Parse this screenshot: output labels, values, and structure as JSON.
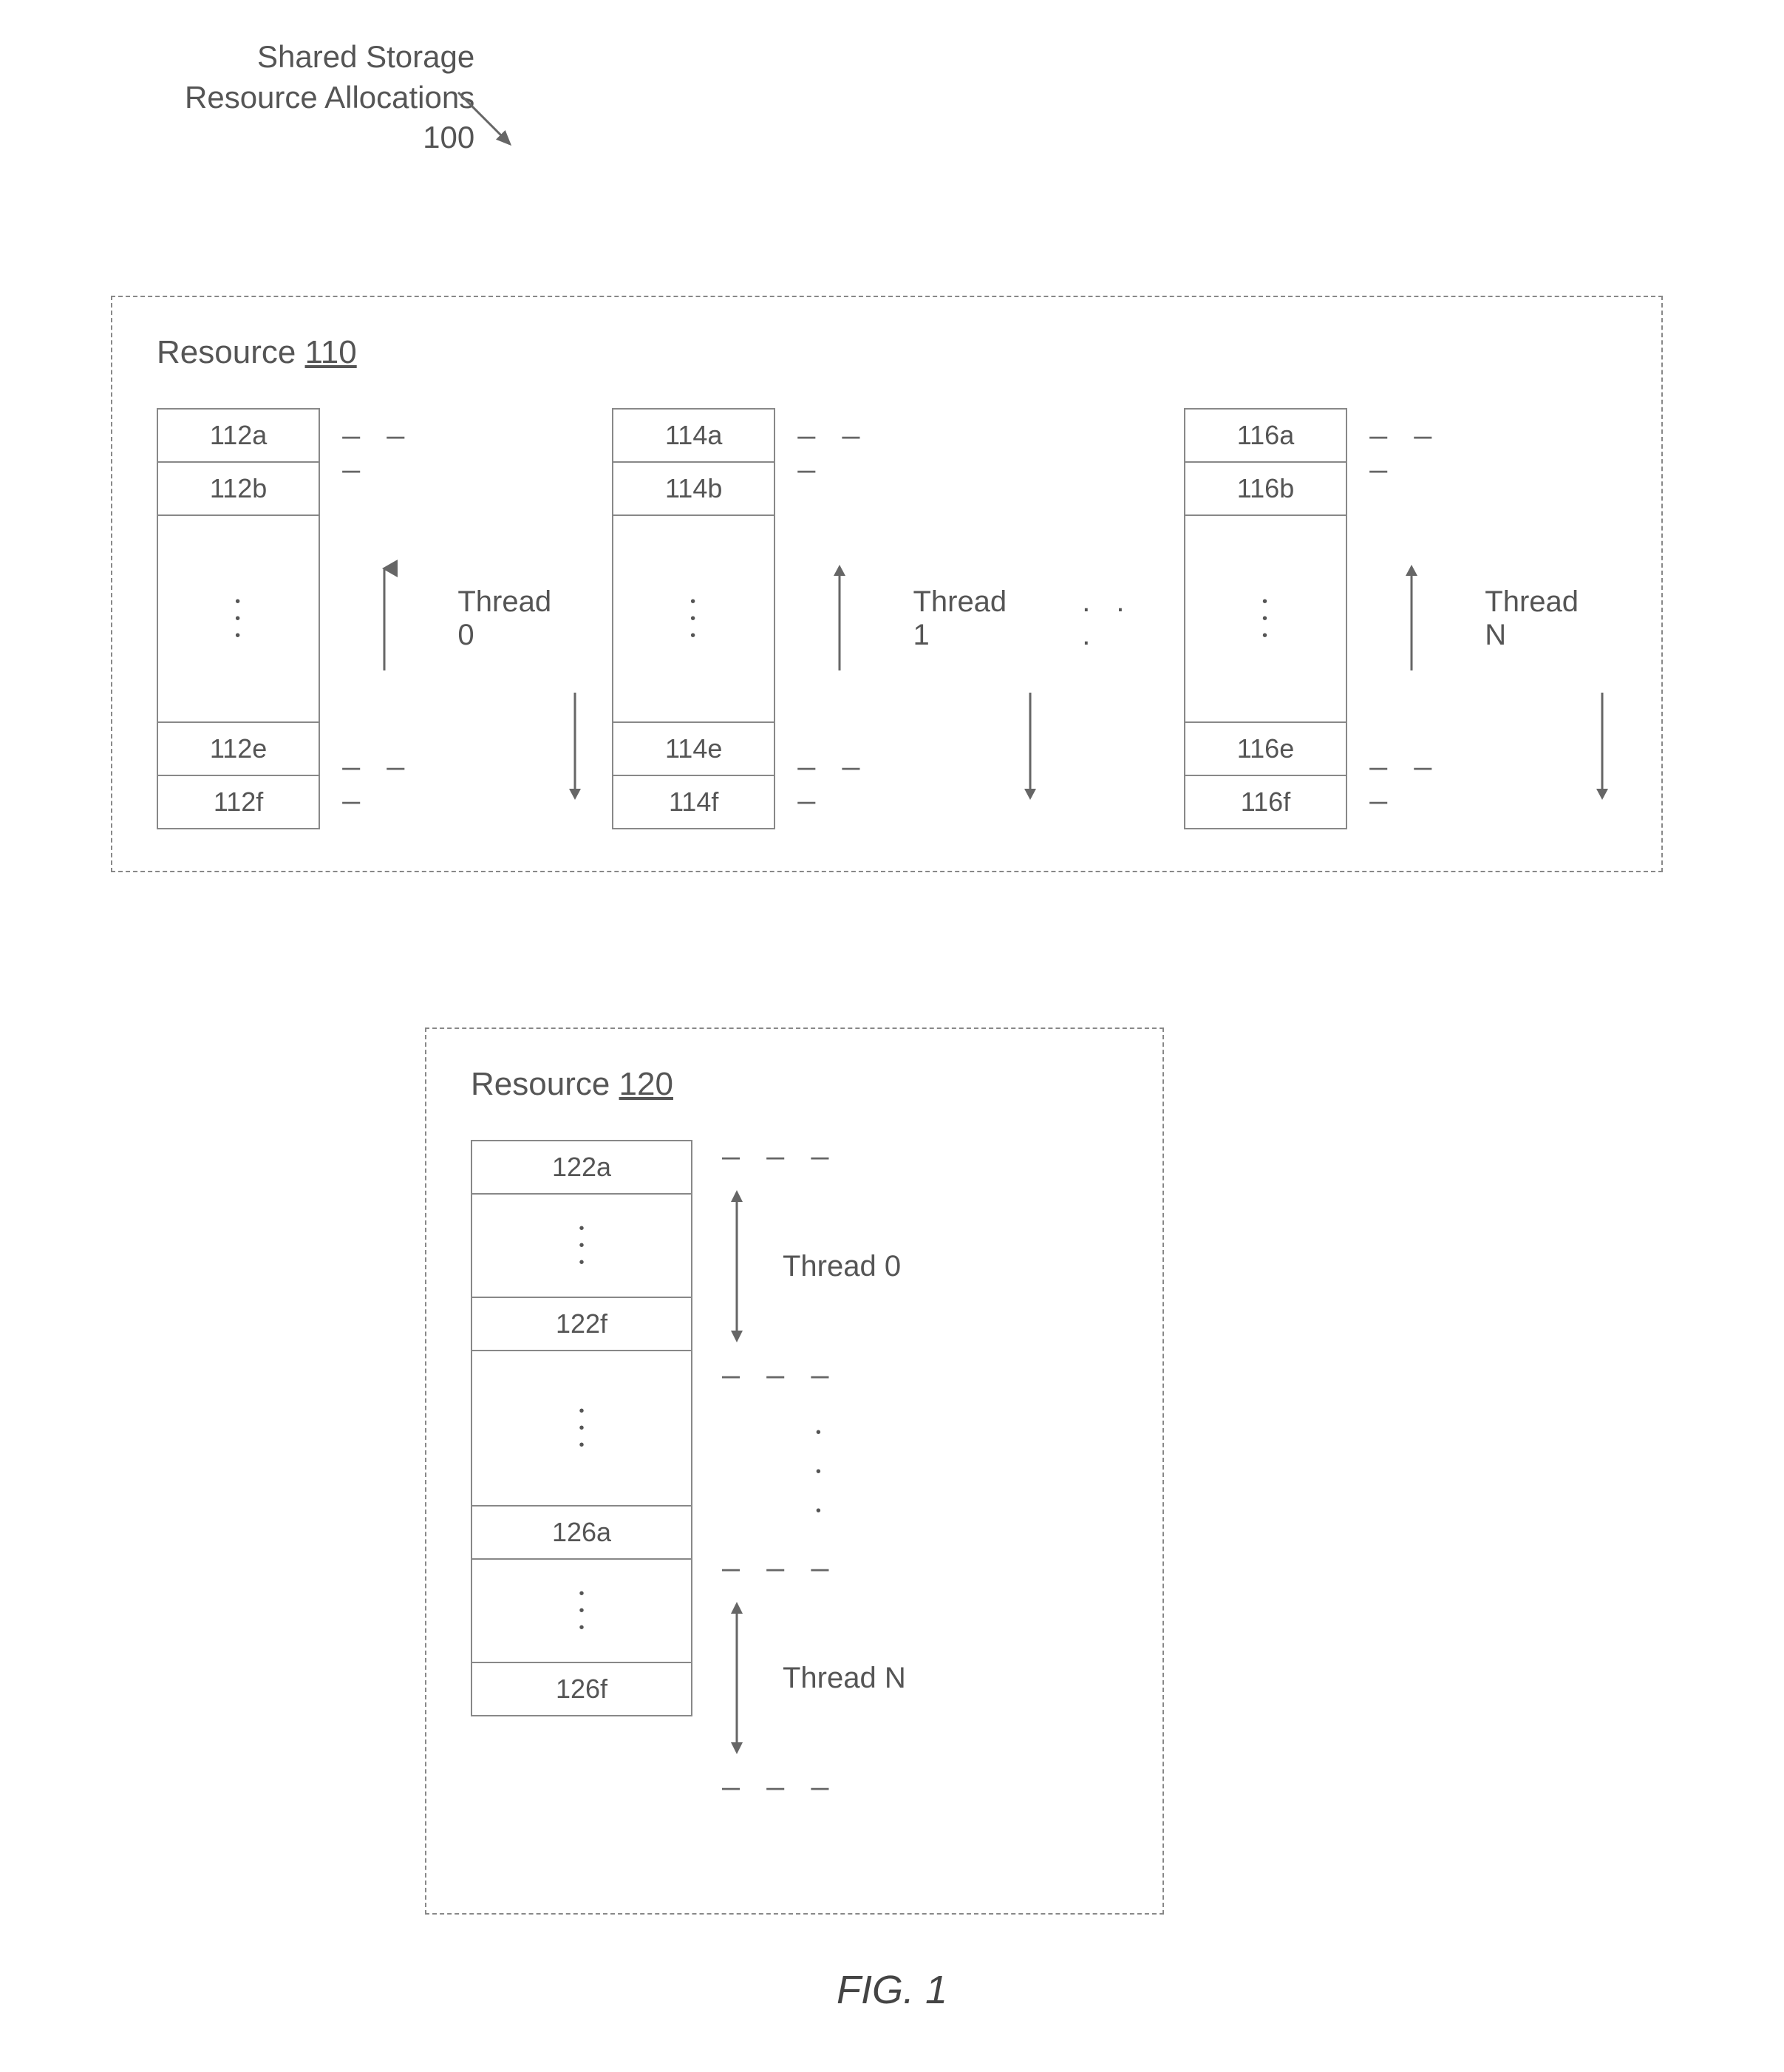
{
  "title": {
    "line1": "Shared Storage",
    "line2": "Resource Allocations",
    "num": "100"
  },
  "resource110": {
    "label": "Resource",
    "num": "110",
    "cols": [
      {
        "a": "112a",
        "b": "112b",
        "e": "112e",
        "f": "112f",
        "thread": "Thread 0"
      },
      {
        "a": "114a",
        "b": "114b",
        "e": "114e",
        "f": "114f",
        "thread": "Thread 1"
      },
      {
        "a": "116a",
        "b": "116b",
        "e": "116e",
        "f": "116f",
        "thread": "Thread N"
      }
    ],
    "ellipsis": ". . ."
  },
  "resource120": {
    "label": "Resource",
    "num": "120",
    "slots": {
      "s1": "122a",
      "s2": "122f",
      "s3": "126a",
      "s4": "126f"
    },
    "thread0": "Thread 0",
    "threadN": "Thread N"
  },
  "figure": "FIG. 1",
  "dash": "— — —"
}
